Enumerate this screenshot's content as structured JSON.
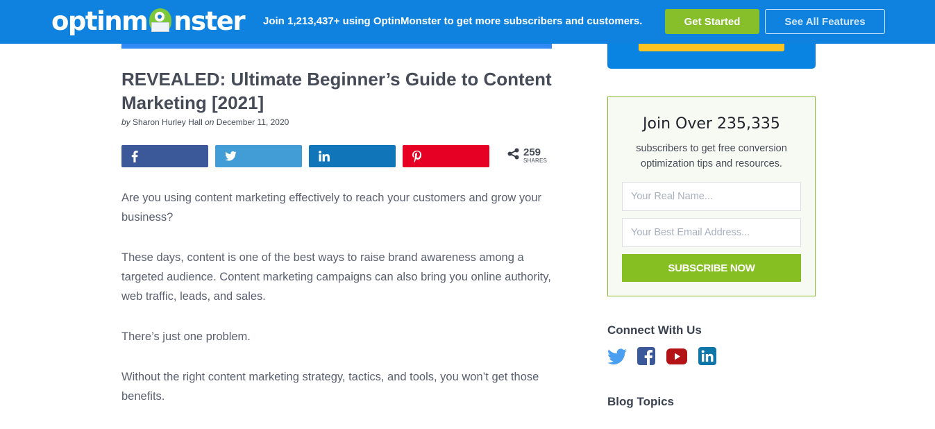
{
  "header": {
    "logo_text_left": "optinm",
    "logo_text_right": "nster",
    "logo_icon": "monster-mascot-icon",
    "tagline": "Join 1,213,437+ using OptinMonster to get more subscribers and customers.",
    "get_started_label": "Get Started",
    "see_features_label": "See All Features",
    "colors": {
      "bar": "#0f82e0",
      "get_started": "#86bf2a"
    }
  },
  "article": {
    "title": "REVEALED: Ultimate Beginner’s Guide to Content Marketing [2021]",
    "byline": {
      "by": "by",
      "author": "Sharon Hurley Hall",
      "on": "on",
      "date": "December 11, 2020"
    },
    "share": {
      "buttons": [
        {
          "network": "facebook",
          "icon": "facebook-icon",
          "color": "#3b5998"
        },
        {
          "network": "twitter",
          "icon": "twitter-icon",
          "color": "#429cd6"
        },
        {
          "network": "linkedin",
          "icon": "linkedin-icon",
          "color": "#1175b9"
        },
        {
          "network": "pinterest",
          "icon": "pinterest-icon",
          "color": "#e60023"
        }
      ],
      "count": "259",
      "count_label": "SHARES",
      "count_icon": "share-icon"
    },
    "paragraphs": [
      "Are you using content marketing effectively to reach your customers and grow your business?",
      "These days, content is one of the best ways to raise brand awareness among a targeted audience. Content marketing campaigns can also bring you online authority, web traffic, leads, and sales.",
      "There’s just one problem.",
      "Without the right content marketing strategy, tactics, and tools, you won’t get those benefits."
    ]
  },
  "sidebar": {
    "optin": {
      "title": "Join Over 235,335",
      "subtitle": "subscribers to get free conversion optimization tips and resources.",
      "name_placeholder": "Your Real Name...",
      "email_placeholder": "Your Best Email Address...",
      "submit_label": "SUBSCRIBE NOW",
      "colors": {
        "border": "#86bf2a",
        "button": "#86bf22"
      }
    },
    "connect": {
      "heading": "Connect With Us",
      "icons": [
        "twitter-icon",
        "facebook-icon",
        "youtube-icon",
        "linkedin-icon"
      ]
    },
    "blog_topics_heading": "Blog Topics"
  }
}
